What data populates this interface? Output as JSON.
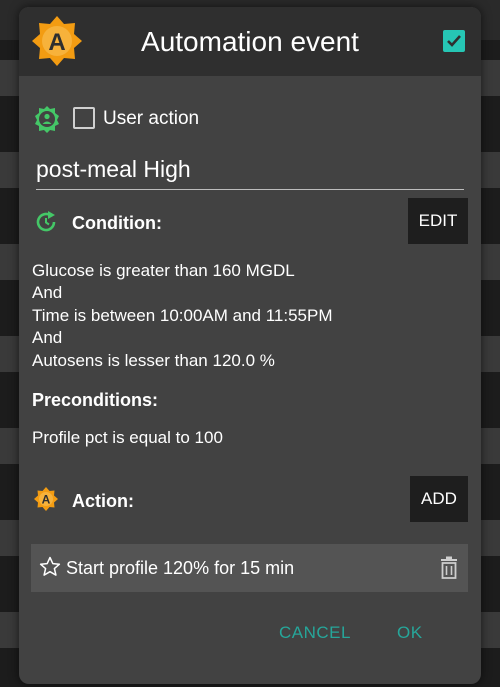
{
  "dialog": {
    "title": "Automation event",
    "logo_letter": "A",
    "confirm_icon": "checkbox-checked-icon"
  },
  "user_action": {
    "label": "User action",
    "checked": false,
    "icon": "person-gear-icon"
  },
  "event_name": "post-meal High",
  "condition": {
    "label": "Condition:",
    "edit_label": "EDIT",
    "icon": "refresh-icon",
    "lines": [
      "Glucose is greater than 160 MGDL",
      "And",
      "Time is between 10:00AM and 11:55PM",
      "And",
      "Autosens is lesser than 120.0 %"
    ]
  },
  "preconditions": {
    "label": "Preconditions:",
    "lines": [
      "Profile pct is equal to 100"
    ]
  },
  "action": {
    "label": "Action:",
    "add_label": "ADD",
    "icon": "aaps-logo-icon",
    "items": [
      {
        "text": "Start profile 120% for 15 min",
        "icon": "star-outline-icon",
        "delete_icon": "trash-icon"
      }
    ]
  },
  "footer": {
    "cancel_label": "CANCEL",
    "ok_label": "OK"
  },
  "colors": {
    "accent": "#26a69a",
    "logo": "#f39c12",
    "condition_icon": "#44c767",
    "checkbox": "#26c6b4"
  }
}
